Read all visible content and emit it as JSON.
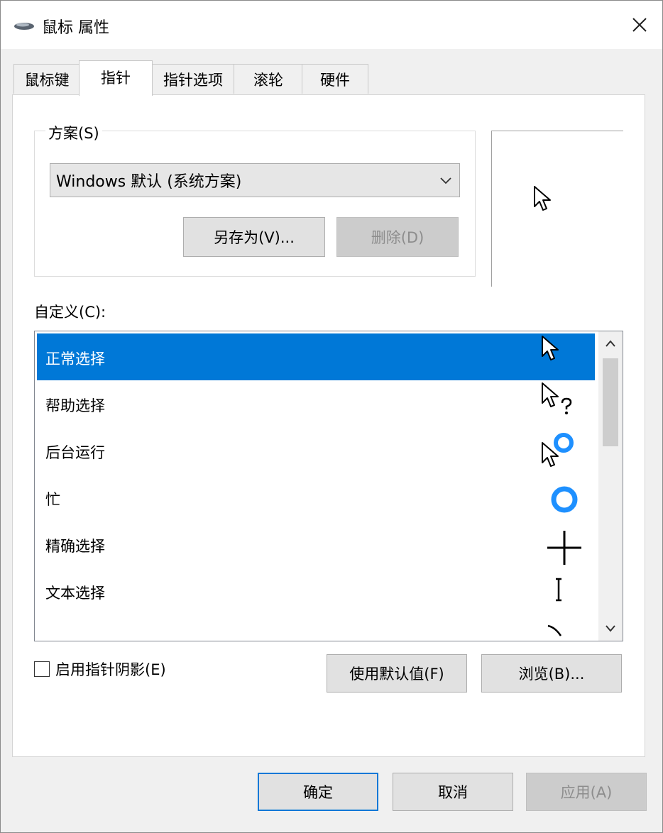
{
  "window": {
    "title": "鼠标 属性"
  },
  "tabs": [
    {
      "label": "鼠标键"
    },
    {
      "label": "指针"
    },
    {
      "label": "指针选项"
    },
    {
      "label": "滚轮"
    },
    {
      "label": "硬件"
    }
  ],
  "active_tab": "指针",
  "scheme": {
    "group_label": "方案(S)",
    "selected": "Windows 默认 (系统方案)",
    "save_as_label": "另存为(V)...",
    "delete_label": "删除(D)"
  },
  "customize": {
    "label": "自定义(C):",
    "items": [
      {
        "label": "正常选择",
        "cursor": "arrow-cursor-icon"
      },
      {
        "label": "帮助选择",
        "cursor": "help-cursor-icon"
      },
      {
        "label": "后台运行",
        "cursor": "working-cursor-icon"
      },
      {
        "label": "忙",
        "cursor": "busy-cursor-icon"
      },
      {
        "label": "精确选择",
        "cursor": "crosshair-cursor-icon"
      },
      {
        "label": "文本选择",
        "cursor": "text-cursor-icon"
      },
      {
        "label": "",
        "cursor": "handwriting-cursor-icon"
      }
    ],
    "selected_index": 0
  },
  "shadow": {
    "label": "启用指针阴影(E)",
    "checked": false
  },
  "buttons": {
    "use_default": "使用默认值(F)",
    "browse": "浏览(B)...",
    "ok": "确定",
    "cancel": "取消",
    "apply": "应用(A)"
  },
  "colors": {
    "selection": "#0078d7",
    "busy_ring": "#1e90ff"
  }
}
